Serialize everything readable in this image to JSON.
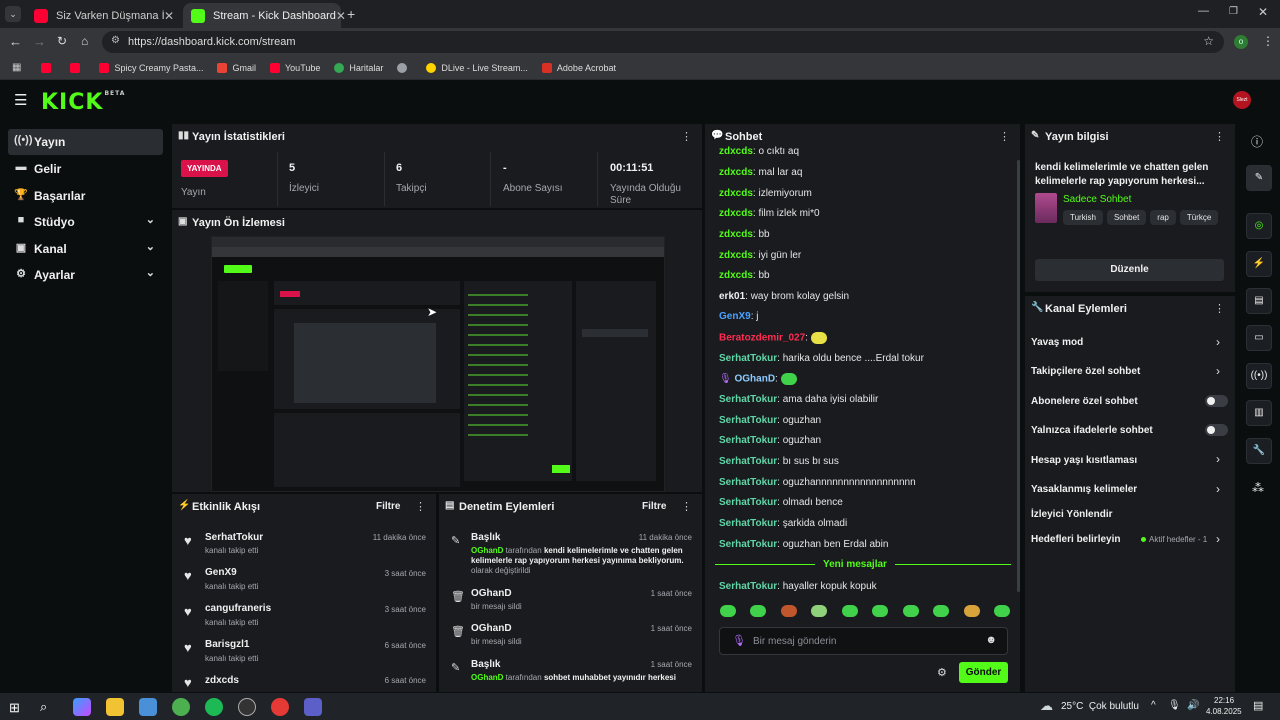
{
  "browser": {
    "tabs": [
      {
        "title": "Siz Varken Düşmana İhtiyaç Yo"
      },
      {
        "title": "Stream - Kick Dashboard"
      }
    ],
    "url": "https://dashboard.kick.com/stream",
    "bookmarks": [
      "Spicy Creamy Pasta...",
      "Gmail",
      "YouTube",
      "Haritalar",
      "DLive - Live Stream...",
      "Adobe Acrobat"
    ]
  },
  "app": {
    "logo": "KICK",
    "logo_sup": "BETA",
    "avatar_label": "Slezt",
    "accent": "#53fc18"
  },
  "sidebar": {
    "items": [
      {
        "label": "Yayın",
        "icon": "broadcast-icon"
      },
      {
        "label": "Gelir",
        "icon": "money-icon"
      },
      {
        "label": "Başarılar",
        "icon": "trophy-icon"
      },
      {
        "label": "Stüdyo",
        "icon": "studio-icon"
      },
      {
        "label": "Kanal",
        "icon": "channel-icon"
      },
      {
        "label": "Ayarlar",
        "icon": "gear-icon"
      }
    ]
  },
  "stats": {
    "title": "Yayın İstatistikleri",
    "live_badge": "YAYINDA",
    "live_label": "Yayın",
    "viewers": {
      "value": "5",
      "label": "İzleyici"
    },
    "followers": {
      "value": "6",
      "label": "Takipçi"
    },
    "subs": {
      "value": "-",
      "label": "Abone Sayısı"
    },
    "uptime": {
      "value": "00:11:51",
      "label": "Yayında Olduğu Süre"
    }
  },
  "preview": {
    "title": "Yayın Ön İzlemesi"
  },
  "activity": {
    "title": "Etkinlik Akışı",
    "filter": "Filtre",
    "items": [
      {
        "name": "SerhatTokur",
        "desc": "kanalı takip etti",
        "time": "11 dakika önce"
      },
      {
        "name": "GenX9",
        "desc": "kanalı takip etti",
        "time": "3 saat önce"
      },
      {
        "name": "cangufraneris",
        "desc": "kanalı takip etti",
        "time": "3 saat önce"
      },
      {
        "name": "Barisgzl1",
        "desc": "kanalı takip etti",
        "time": "6 saat önce"
      },
      {
        "name": "zdxcds",
        "desc": "",
        "time": "6 saat önce"
      }
    ]
  },
  "moderation": {
    "title": "Denetim Eylemleri",
    "filter": "Filtre",
    "items": [
      {
        "title": "Başlık",
        "time": "11 dakika önce",
        "actor": "OGhanD",
        "mid": " tarafından ",
        "content": "kendi kelimelerimle ve chatten gelen kelimelerle rap yapıyorum herkesi yayınıma bekliyorum.",
        "end": " olarak değiştirildi"
      },
      {
        "title": "OGhanD",
        "time": "1 saat önce",
        "desc": "bir mesajı sildi"
      },
      {
        "title": "OGhanD",
        "time": "1 saat önce",
        "desc": "bir mesajı sildi"
      },
      {
        "title": "Başlık",
        "time": "1 saat önce",
        "actor": "OGhanD",
        "mid": " tarafından ",
        "content": "sohbet muhabbet yayınıdır herkesi"
      }
    ]
  },
  "chat": {
    "title": "Sohbet",
    "messages": [
      {
        "user": "zdxcds",
        "color": "green",
        "text": "o cıktı aq"
      },
      {
        "user": "zdxcds",
        "color": "green",
        "text": "mal lar aq"
      },
      {
        "user": "zdxcds",
        "color": "green",
        "text": "izlemiyorum"
      },
      {
        "user": "zdxcds",
        "color": "green",
        "text": "film izlek mi*0"
      },
      {
        "user": "zdxcds",
        "color": "green",
        "text": "bb"
      },
      {
        "user": "zdxcds",
        "color": "green",
        "text": "iyi gün ler"
      },
      {
        "user": "zdxcds",
        "color": "green",
        "text": "bb"
      },
      {
        "user": "erk01",
        "color": "white",
        "text": "way brom kolay gelsin"
      },
      {
        "user": "GenX9",
        "color": "blue",
        "text": "j"
      },
      {
        "user": "Beratozdemir_027",
        "color": "red",
        "text": ""
      },
      {
        "user": "SerhatTokur",
        "color": "teal",
        "text": "harika oldu bence ....Erdal tokur"
      },
      {
        "user": "OGhanD",
        "color": "teal",
        "text": ""
      },
      {
        "user": "SerhatTokur",
        "color": "teal",
        "text": "ama daha iyisi olabilir"
      },
      {
        "user": "SerhatTokur",
        "color": "teal",
        "text": "oguzhan"
      },
      {
        "user": "SerhatTokur",
        "color": "teal",
        "text": "oguzhan"
      },
      {
        "user": "SerhatTokur",
        "color": "teal",
        "text": "bı sus bı sus"
      },
      {
        "user": "SerhatTokur",
        "color": "teal",
        "text": "oguzhannnnnnnnnnnnnnnnnn"
      },
      {
        "user": "SerhatTokur",
        "color": "teal",
        "text": "olmadı bence"
      },
      {
        "user": "SerhatTokur",
        "color": "teal",
        "text": "şarkida olmadi"
      },
      {
        "user": "SerhatTokur",
        "color": "teal",
        "text": "oguzhan ben Erdal abin"
      }
    ],
    "new_messages": "Yeni mesajlar",
    "last": {
      "user": "SerhatTokur",
      "text": "hayaller kopuk kopuk"
    },
    "placeholder": "Bir mesaj gönderin",
    "send": "Gönder"
  },
  "stream_info": {
    "title": "Yayın bilgisi",
    "stream_title": "kendi kelimelerimle ve chatten gelen kelimelerle rap yapıyorum herkesi...",
    "category": "Sadece Sohbet",
    "tags": [
      "Turkish",
      "Sohbet",
      "rap",
      "Türkçe"
    ],
    "edit": "Düzenle"
  },
  "channel_actions": {
    "title": "Kanal Eylemleri",
    "items": [
      {
        "label": "Yavaş mod",
        "control": "chevron"
      },
      {
        "label": "Takipçilere özel sohbet",
        "control": "chevron"
      },
      {
        "label": "Abonelere özel sohbet",
        "control": "toggle"
      },
      {
        "label": "Yalnızca ifadelerle sohbet",
        "control": "toggle"
      },
      {
        "label": "Hesap yaşı kısıtlaması",
        "control": "chevron"
      },
      {
        "label": "Yasaklanmış kelimeler",
        "control": "chevron"
      },
      {
        "label": "İzleyici Yönlendir",
        "control": "none"
      },
      {
        "label": "Hedefleri belirleyin",
        "control": "chevron"
      }
    ],
    "goals_status": "Aktif hedefler - 1"
  },
  "taskbar": {
    "weather": "25°C  Çok bulutlu",
    "time": "22:16",
    "date": "4.08.2025"
  }
}
